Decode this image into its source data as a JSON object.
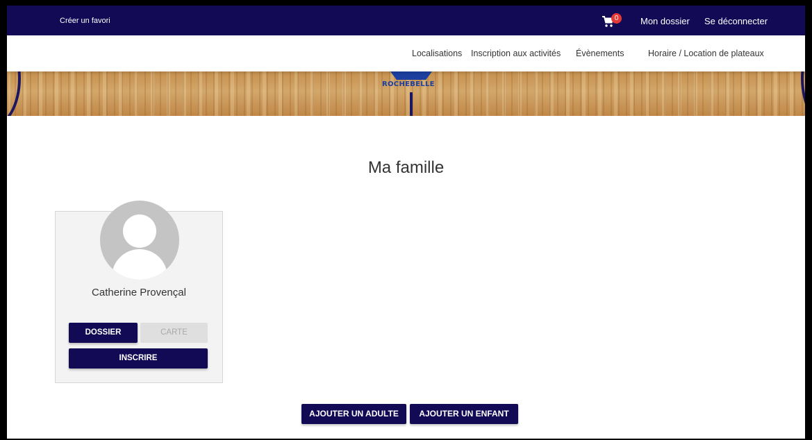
{
  "topbar": {
    "favorite_link": "Créer un favori",
    "cart_count": "0",
    "my_file_link": "Mon dossier",
    "logout_link": "Se déconnecter",
    "background_color": "#120a55"
  },
  "nav": {
    "items": [
      {
        "label": "Localisations"
      },
      {
        "label": "Inscription aux activités"
      },
      {
        "label": "Évènements"
      },
      {
        "label": "Horaire / Location de plateaux"
      }
    ]
  },
  "banner": {
    "logo_text": "ROCHEBELLE"
  },
  "page": {
    "title": "Ma famille"
  },
  "members": [
    {
      "name": "Catherine Provençal",
      "dossier_button": "DOSSIER",
      "card_button": "CARTE",
      "register_button": "INSCRIRE"
    }
  ],
  "actions": {
    "add_adult": "AJOUTER UN ADULTE",
    "add_child": "AJOUTER UN ENFANT"
  },
  "colors": {
    "primary": "#120a55",
    "badge": "#e53935",
    "disabled": "#dfdfdf"
  }
}
